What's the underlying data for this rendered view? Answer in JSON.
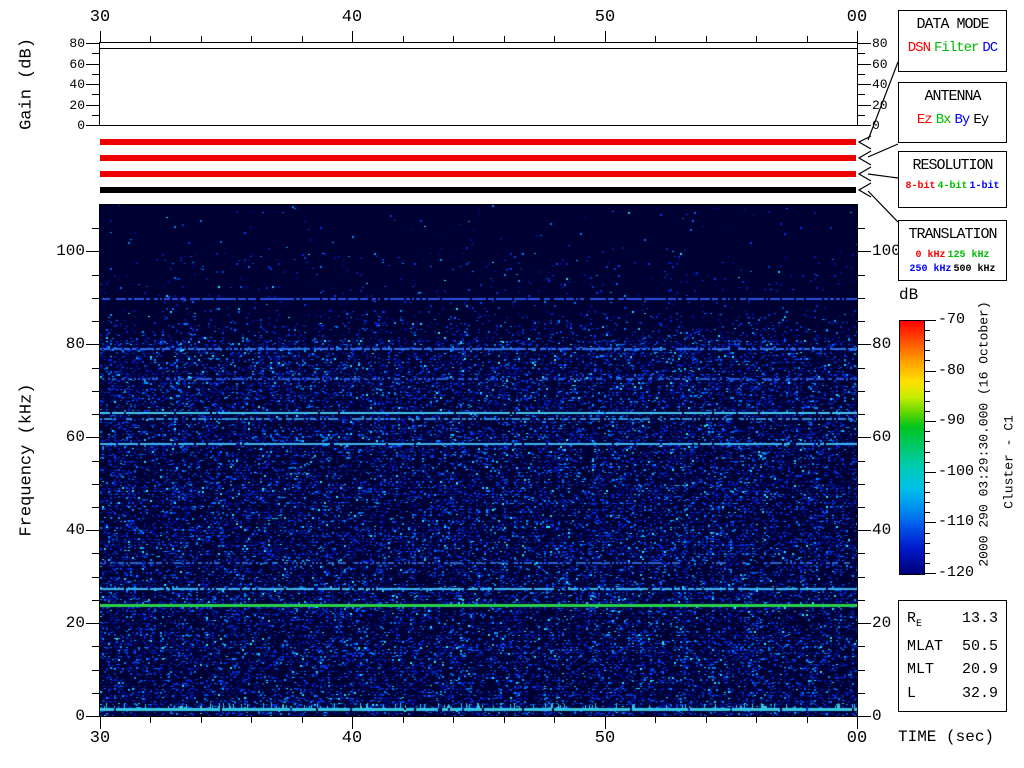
{
  "axes": {
    "gain_label": "Gain (dB)",
    "freq_label": "Frequency (kHz)",
    "time_label": "TIME (sec)",
    "time_tick_labels": [
      "30",
      "40",
      "50",
      "00"
    ],
    "gain_tick_labels": [
      "0",
      "20",
      "40",
      "60",
      "80"
    ],
    "freq_tick_labels": [
      "0",
      "20",
      "40",
      "60",
      "80",
      "100"
    ]
  },
  "panels": [
    {
      "title": "DATA MODE",
      "items": [
        {
          "text": "DSN",
          "color": "#ff0000"
        },
        {
          "text": "Filter",
          "color": "#00bb00"
        },
        {
          "text": "DC",
          "color": "#0000ff"
        }
      ]
    },
    {
      "title": "ANTENNA",
      "items": [
        {
          "text": "Ez",
          "color": "#ff0000"
        },
        {
          "text": "Bx",
          "color": "#00bb00"
        },
        {
          "text": "By",
          "color": "#0000ff"
        },
        {
          "text": "Ey",
          "color": "#000000"
        }
      ]
    },
    {
      "title": "RESOLUTION",
      "items": [
        {
          "text": "8-bit",
          "color": "#ff0000"
        },
        {
          "text": "4-bit",
          "color": "#00bb00"
        },
        {
          "text": "1-bit",
          "color": "#0000ff"
        }
      ]
    },
    {
      "title": "TRANSLATION",
      "two_lines": true,
      "items": [
        {
          "text": "0 kHz",
          "color": "#ff0000"
        },
        {
          "text": "125 kHz",
          "color": "#00bb00"
        },
        {
          "text": "250 kHz",
          "color": "#0000ff"
        },
        {
          "text": "500 kHz",
          "color": "#000000"
        }
      ]
    }
  ],
  "status_bars": [
    {
      "name": "data-mode-status-bar",
      "color": "#ee0000"
    },
    {
      "name": "antenna-status-bar",
      "color": "#ee0000"
    },
    {
      "name": "resolution-status-bar",
      "color": "#ee0000"
    },
    {
      "name": "translation-status-bar",
      "color": "#000000"
    }
  ],
  "colorbar": {
    "title": "dB",
    "tick_labels": [
      "-70",
      "-80",
      "-90",
      "-100",
      "-110",
      "-120"
    ]
  },
  "side_text": {
    "datetime": "2000 290 03:29:30.000 (16 October)",
    "spacecraft": "Cluster - C1"
  },
  "ephemeris": [
    {
      "label": "R",
      "sub": "E",
      "value": "13.3"
    },
    {
      "label": "MLAT",
      "sub": "",
      "value": "50.5"
    },
    {
      "label": "MLT",
      "sub": "",
      "value": "20.9"
    },
    {
      "label": "L",
      "sub": "",
      "value": "32.9"
    }
  ],
  "chart_data": [
    {
      "type": "line",
      "title": "Receiver gain vs time",
      "ylabel": "Gain (dB)",
      "xlabel": "TIME (sec)",
      "x_tick_labels": [
        "30",
        "40",
        "50",
        "00"
      ],
      "xlim": [
        30,
        60
      ],
      "ylim": [
        0,
        80
      ],
      "y_ticks": [
        0,
        20,
        40,
        60,
        80
      ],
      "grid": false,
      "series": [
        {
          "name": "gain",
          "x": [
            30,
            60
          ],
          "values": [
            75,
            75
          ]
        }
      ]
    },
    {
      "type": "heatmap",
      "title": "Cluster C1 WBD spectrogram",
      "ylabel": "Frequency (kHz)",
      "xlabel": "TIME (sec)",
      "x_tick_labels": [
        "30",
        "40",
        "50",
        "00"
      ],
      "xlim": [
        30,
        60
      ],
      "ylim": [
        0,
        110
      ],
      "y_ticks": [
        0,
        20,
        40,
        60,
        80,
        100
      ],
      "colorbar": {
        "label": "dB",
        "min": -120,
        "max": -70,
        "tick_step": 10
      },
      "noise_floor_dB": -120,
      "noise_upper_cutoff_khz": 81,
      "spectral_lines": [
        {
          "freq_khz": 90.0,
          "dB": -112,
          "color": "#2a50e0",
          "coverage": 0.8,
          "height": 2
        },
        {
          "freq_khz": 79.3,
          "dB": -111,
          "color": "#2f6ce0",
          "coverage": 0.75,
          "height": 2
        },
        {
          "freq_khz": 72.8,
          "dB": -113,
          "color": "#2a55cc",
          "coverage": 0.55,
          "height": 2
        },
        {
          "freq_khz": 65.4,
          "dB": -106,
          "color": "#46c8f0",
          "coverage": 0.95,
          "height": 2
        },
        {
          "freq_khz": 64.2,
          "dB": -110,
          "color": "#2f8cd8",
          "coverage": 0.6,
          "height": 2
        },
        {
          "freq_khz": 58.7,
          "dB": -107,
          "color": "#40b4ea",
          "coverage": 0.9,
          "height": 2
        },
        {
          "freq_khz": 33.2,
          "dB": -113,
          "color": "#2a62cc",
          "coverage": 0.5,
          "height": 2
        },
        {
          "freq_khz": 27.6,
          "dB": -108,
          "color": "#3cb4e6",
          "coverage": 0.85,
          "height": 2
        },
        {
          "freq_khz": 24.2,
          "dB": -96,
          "color": "#28d24a",
          "coverage": 1.0,
          "height": 3
        },
        {
          "freq_khz": 1.8,
          "dB": -105,
          "color": "#38c8e0",
          "coverage": 0.95,
          "height": 3
        }
      ]
    }
  ]
}
